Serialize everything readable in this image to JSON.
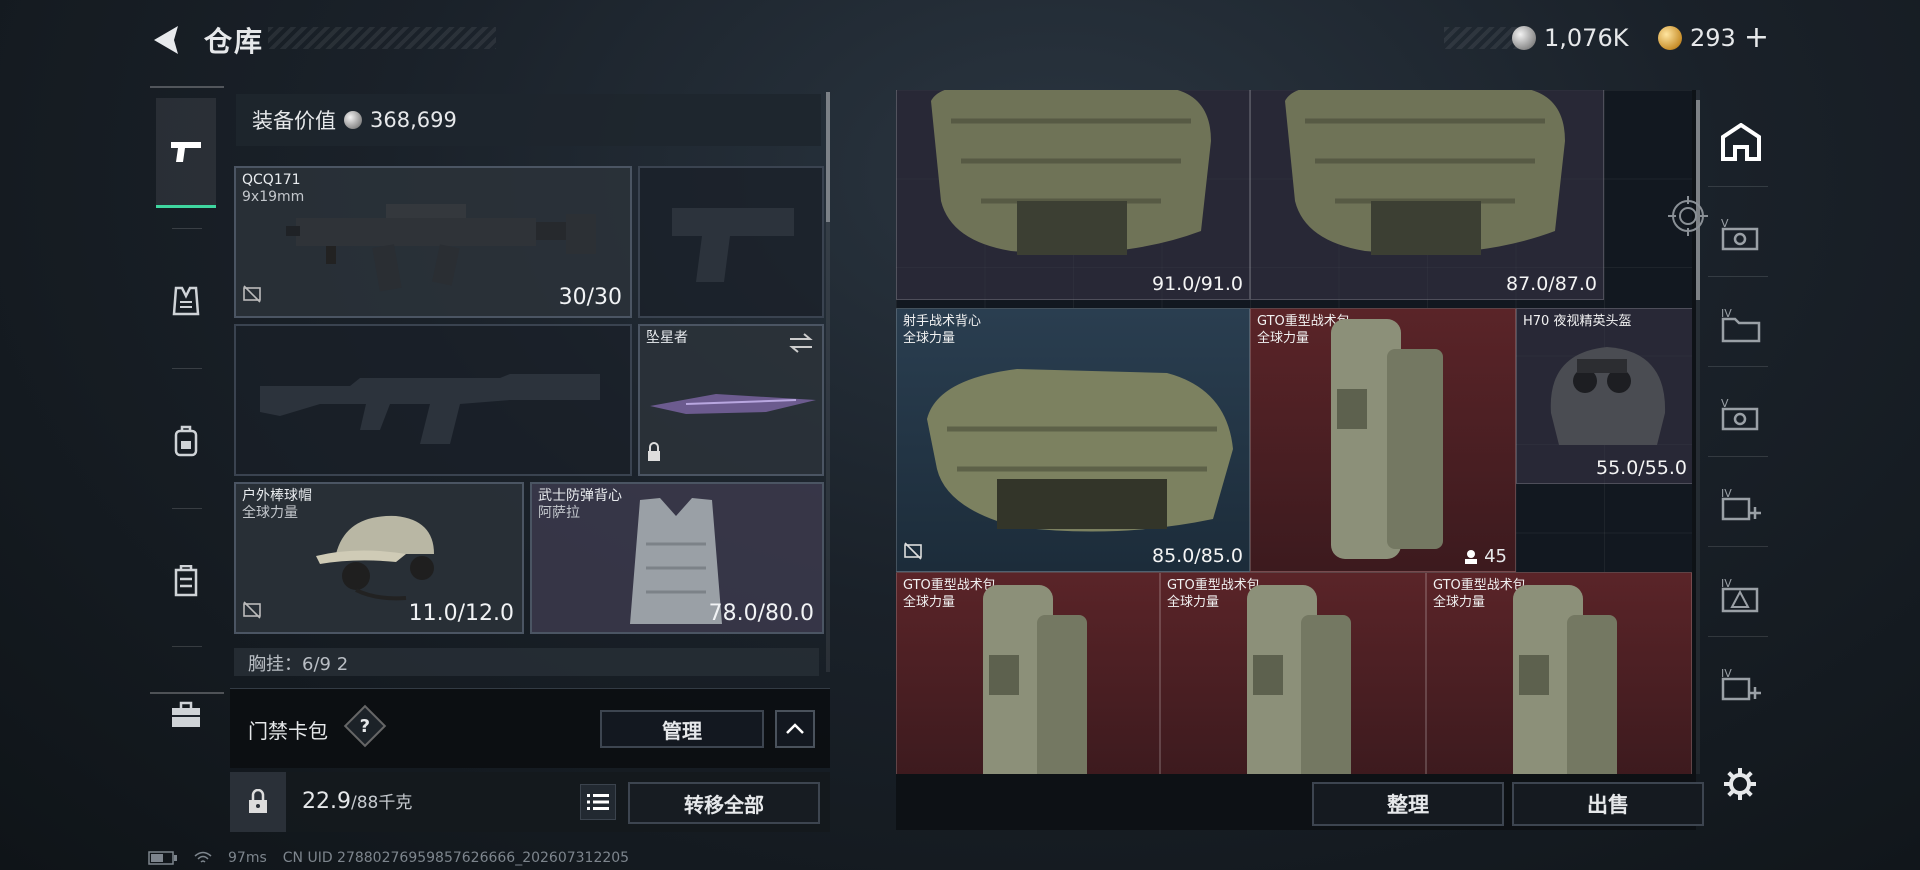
{
  "header": {
    "title": "仓库",
    "silver_amount": "1,076K",
    "gold_amount": "293",
    "plus_label": "+"
  },
  "left_nav": {
    "items": [
      {
        "name": "weapons",
        "icon": "pistol-icon",
        "active": true
      },
      {
        "name": "armor",
        "icon": "vest-icon",
        "active": false
      },
      {
        "name": "backpack",
        "icon": "backpack-icon",
        "active": false
      },
      {
        "name": "chest-rig",
        "icon": "chest-rig-icon",
        "active": false
      },
      {
        "name": "briefcase",
        "icon": "briefcase-icon",
        "active": false
      }
    ]
  },
  "loadout": {
    "equip_value_label": "装备价值",
    "equip_value": "368,699",
    "primary": {
      "name": "QCQ171",
      "caliber": "9x19mm",
      "durability": "30/30"
    },
    "melee": {
      "name": "坠星者"
    },
    "helmet": {
      "name": "户外棒球帽",
      "subtitle": "全球力量",
      "durability": "11.0/12.0"
    },
    "vest": {
      "name": "武士防弹背心",
      "subtitle": "阿萨拉",
      "durability": "78.0/80.0"
    },
    "chest_rig_partial": "胸挂：6/9 2",
    "card_wallet_label": "门禁卡包",
    "help_label": "?",
    "manage_label": "管理",
    "weight": "22.9",
    "weight_max": "/88千克",
    "transfer_all_label": "转移全部"
  },
  "stash": {
    "items": [
      {
        "name": "",
        "subtitle": "",
        "value": "91.0/91.0",
        "color": "gray"
      },
      {
        "name": "",
        "subtitle": "",
        "value": "87.0/87.0",
        "color": "gray"
      },
      {
        "name": "射手战术背心",
        "subtitle": "全球力量",
        "value": "85.0/85.0",
        "color": "blue"
      },
      {
        "name": "GTO重型战术包",
        "subtitle": "全球力量",
        "value": "",
        "count": "45",
        "color": "red"
      },
      {
        "name": "H70 夜视精英头盔",
        "subtitle": "",
        "value": "55.0/55.0",
        "color": "gray"
      },
      {
        "name": "GTO重型战术包",
        "subtitle": "全球力量",
        "value": "",
        "color": "red"
      },
      {
        "name": "GTO重型战术包",
        "subtitle": "全球力量",
        "value": "",
        "color": "red"
      },
      {
        "name": "GTO重型战术包",
        "subtitle": "全球力量",
        "value": "",
        "color": "red"
      }
    ],
    "sort_label": "整理",
    "sell_label": "出售"
  },
  "right_rail": {
    "items": [
      "stash-home-icon",
      "v-tab-icon",
      "iv-folder-icon",
      "v-tab-2-icon",
      "iv-add-icon",
      "iv-warning-icon",
      "iv-add-2-icon",
      "settings-icon"
    ]
  },
  "status": {
    "ping": "97ms",
    "uid": "CN UID 27880276959857626666_202607312205"
  },
  "colors": {
    "accent": "#3fd6a0",
    "stash_red": "#5a2428",
    "stash_blue": "#2a3e50",
    "stash_gray": "#3a3748"
  }
}
